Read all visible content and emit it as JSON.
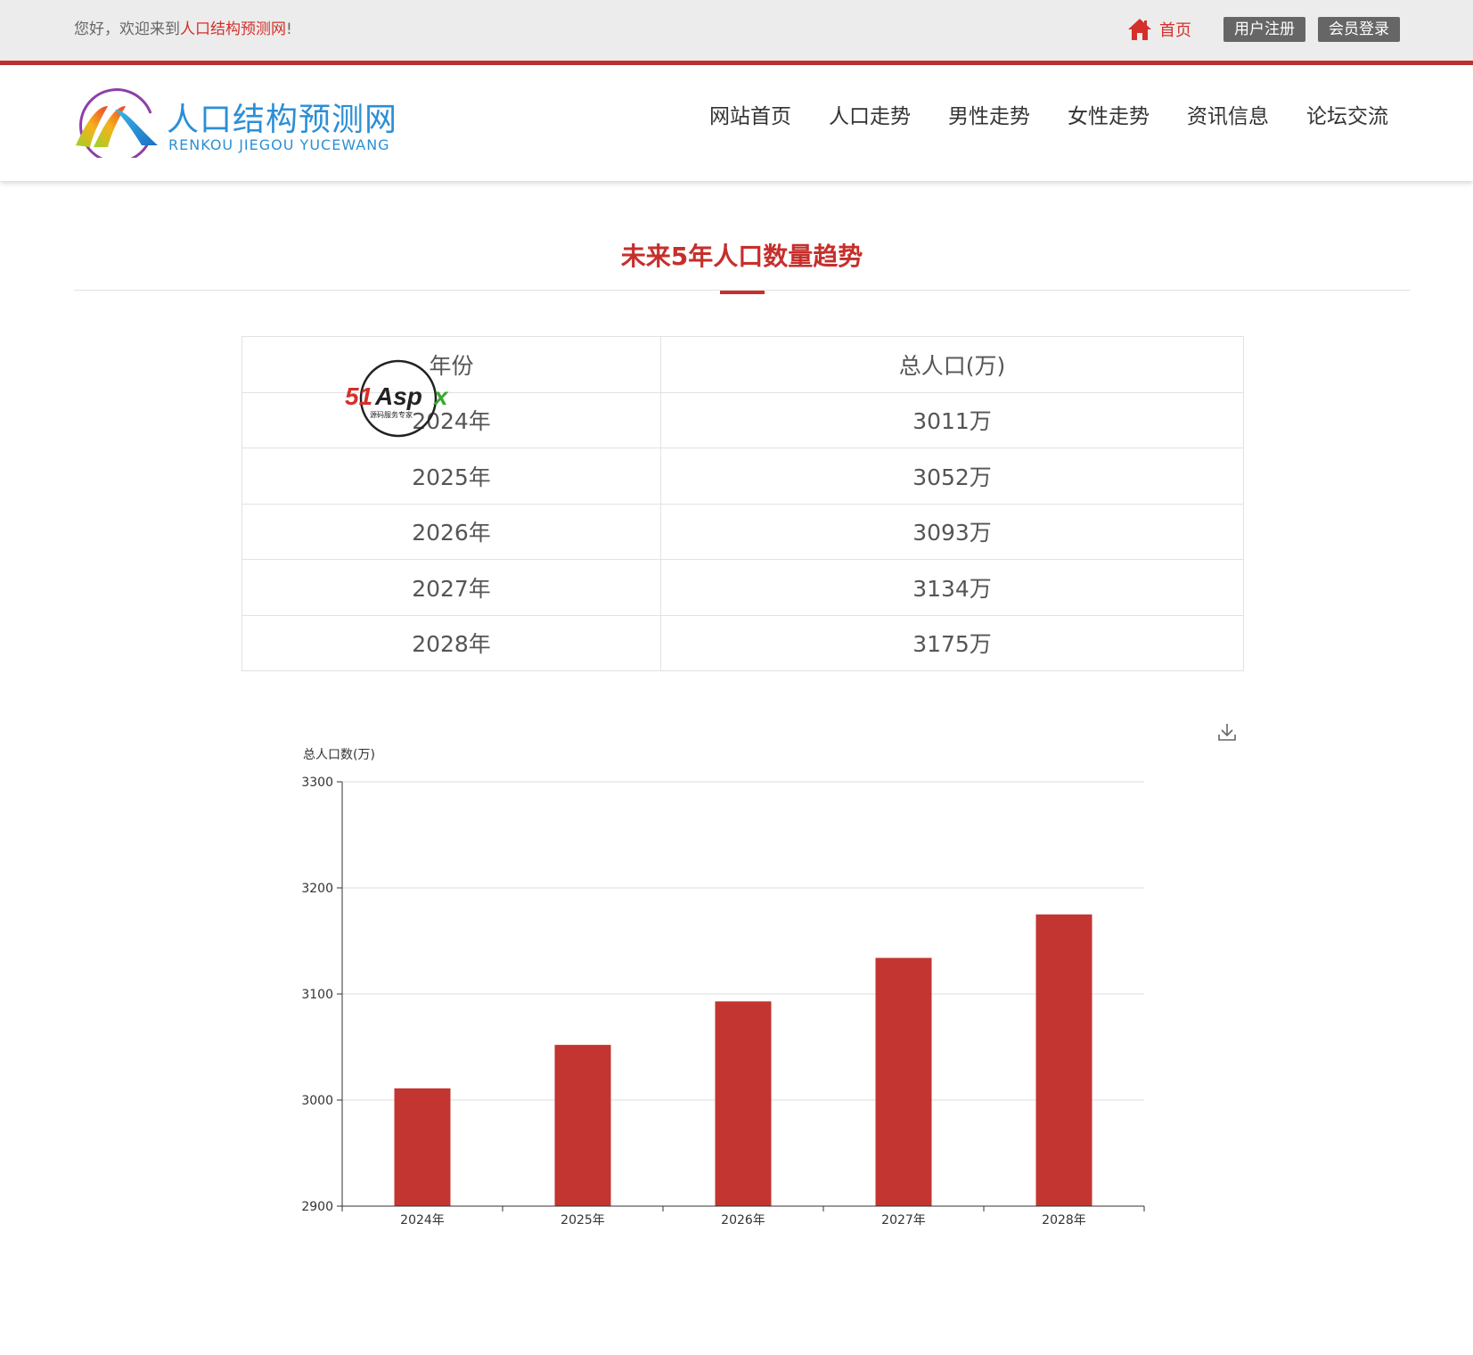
{
  "topbar": {
    "welcome_prefix": "您好，欢迎来到",
    "welcome_site": "人口结构预测网",
    "welcome_suffix": "!",
    "home_label": "首页",
    "register_label": "用户注册",
    "login_label": "会员登录"
  },
  "header": {
    "logo_cn": "人口结构预测网",
    "logo_en": "RENKOU JIEGOU YUCEWANG",
    "nav": [
      "网站首页",
      "人口走势",
      "男性走势",
      "女性走势",
      "资讯信息",
      "论坛交流"
    ]
  },
  "section": {
    "title": "未来5年人口数量趋势"
  },
  "table": {
    "headers": [
      "年份",
      "总人口(万)"
    ],
    "rows": [
      [
        "2024年",
        "3011万"
      ],
      [
        "2025年",
        "3052万"
      ],
      [
        "2026年",
        "3093万"
      ],
      [
        "2027年",
        "3134万"
      ],
      [
        "2028年",
        "3175万"
      ]
    ]
  },
  "watermark": {
    "text": "51Aspx",
    "subtext": "源码服务专家"
  },
  "chart_data": {
    "type": "bar",
    "categories": [
      "2024年",
      "2025年",
      "2026年",
      "2027年",
      "2028年"
    ],
    "values": [
      3011,
      3052,
      3093,
      3134,
      3175
    ],
    "ylabel": "总人口数(万)",
    "ylim": [
      2900,
      3300
    ],
    "yticks": [
      2900,
      3000,
      3100,
      3200,
      3300
    ],
    "grid": true,
    "bar_color": "#c23531"
  },
  "colors": {
    "accent": "#c62f2b",
    "brand": "#2b8fd6"
  }
}
